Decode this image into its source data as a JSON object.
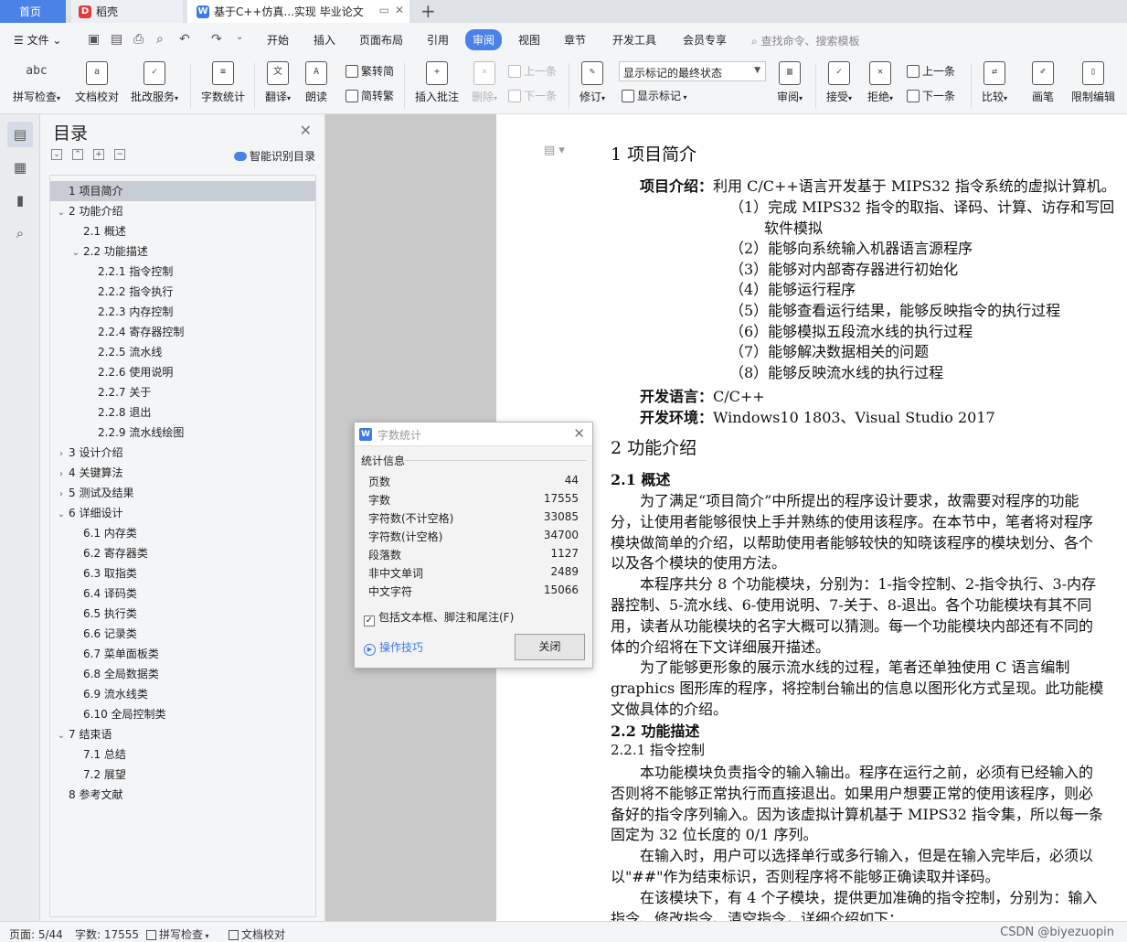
{
  "tabs": {
    "home": "首页",
    "daoke": "稻壳",
    "doc": "基于C++仿真...实现 毕业论文",
    "add": "+"
  },
  "menubar": {
    "file": "文件",
    "items": [
      "开始",
      "插入",
      "页面布局",
      "引用",
      "审阅",
      "视图",
      "章节",
      "开发工具",
      "会员专享"
    ],
    "active_index": 4,
    "search_placeholder": "查找命令、搜索模板"
  },
  "ribbon": {
    "spell_check": "拼写检查",
    "doc_proof": "文档校对",
    "review_service": "批改服务",
    "word_count": "字数统计",
    "translate": "翻译",
    "read_aloud": "朗读",
    "trad_to_simp": "繁转简",
    "simp_to_trad": "简转繁",
    "insert_comment": "插入批注",
    "delete": "删除",
    "prev_comment": "上一条",
    "next_comment": "下一条",
    "track_changes": "修订",
    "markup_mode": "显示标记的最终状态",
    "show_markup": "显示标记",
    "review_pane": "审阅",
    "accept": "接受",
    "reject": "拒绝",
    "prev_change": "上一条",
    "next_change": "下一条",
    "compare": "比较",
    "pen": "画笔",
    "restrict_edit": "限制编辑"
  },
  "toc": {
    "title": "目录",
    "smart_recognize": "智能识别目录",
    "items": [
      {
        "label": "1  项目简介",
        "level": 0,
        "chev": "",
        "selected": true
      },
      {
        "label": "2  功能介绍",
        "level": 0,
        "chev": "v"
      },
      {
        "label": "2.1  概述",
        "level": 1,
        "chev": ""
      },
      {
        "label": "2.2  功能描述",
        "level": 1,
        "chev": "v"
      },
      {
        "label": "2.2.1  指令控制",
        "level": 2,
        "chev": ""
      },
      {
        "label": "2.2.2  指令执行",
        "level": 2,
        "chev": ""
      },
      {
        "label": "2.2.3  内存控制",
        "level": 2,
        "chev": ""
      },
      {
        "label": "2.2.4  寄存器控制",
        "level": 2,
        "chev": ""
      },
      {
        "label": "2.2.5  流水线",
        "level": 2,
        "chev": ""
      },
      {
        "label": "2.2.6  使用说明",
        "level": 2,
        "chev": ""
      },
      {
        "label": "2.2.7  关于",
        "level": 2,
        "chev": ""
      },
      {
        "label": "2.2.8  退出",
        "level": 2,
        "chev": ""
      },
      {
        "label": "2.2.9  流水线绘图",
        "level": 2,
        "chev": ""
      },
      {
        "label": "3  设计介绍",
        "level": 0,
        "chev": ">"
      },
      {
        "label": "4  关键算法",
        "level": 0,
        "chev": ">"
      },
      {
        "label": "5  测试及结果",
        "level": 0,
        "chev": ">"
      },
      {
        "label": "6  详细设计",
        "level": 0,
        "chev": "v"
      },
      {
        "label": "6.1  内存类",
        "level": 1,
        "chev": ""
      },
      {
        "label": "6.2  寄存器类",
        "level": 1,
        "chev": ""
      },
      {
        "label": "6.3  取指类",
        "level": 1,
        "chev": ""
      },
      {
        "label": "6.4  译码类",
        "level": 1,
        "chev": ""
      },
      {
        "label": "6.5  执行类",
        "level": 1,
        "chev": ""
      },
      {
        "label": "6.6  记录类",
        "level": 1,
        "chev": ""
      },
      {
        "label": "6.7  菜单面板类",
        "level": 1,
        "chev": ""
      },
      {
        "label": "6.8  全局数据类",
        "level": 1,
        "chev": ""
      },
      {
        "label": "6.9  流水线类",
        "level": 1,
        "chev": ""
      },
      {
        "label": "6.10  全局控制类",
        "level": 1,
        "chev": ""
      },
      {
        "label": "7  结束语",
        "level": 0,
        "chev": "v"
      },
      {
        "label": "7.1  总结",
        "level": 1,
        "chev": ""
      },
      {
        "label": "7.2  展望",
        "level": 1,
        "chev": ""
      },
      {
        "label": "8  参考文献",
        "level": 0,
        "chev": ""
      }
    ]
  },
  "document": {
    "h1_intro": "1  项目简介",
    "intro_label": "项目介绍：",
    "intro_text": "利用 C/C++语言开发基于 MIPS32 指令系统的虚拟计算机。",
    "features": [
      "（1）完成 MIPS32 指令的取指、译码、计算、访存和写回",
      "软件模拟",
      "（2）能够向系统输入机器语言源程序",
      "（3）能够对内部寄存器进行初始化",
      "（4）能够运行程序",
      "（5）能够查看运行结果，能够反映指令的执行过程",
      "（6）能够模拟五段流水线的执行过程",
      "（7）能够解决数据相关的问题",
      "（8）能够反映流水线的执行过程"
    ],
    "lang_label": "开发语言：",
    "lang_value": "C/C++",
    "env_label": "开发环境：",
    "env_value": "Windows10 1803、Visual Studio 2017",
    "h1_func": "2  功能介绍",
    "h2_overview": "2.1  概述",
    "para_lines": [
      "为了满足“项目简介”中所提出的程序设计要求，故需要对程序的功能",
      "分，让使用者能够很快上手并熟练的使用该程序。在本节中，笔者将对程序",
      "模块做简单的介绍，以帮助使用者能够较快的知晓该程序的模块划分、各个",
      "以及各个模块的使用方法。",
      "本程序共分 8 个功能模块，分别为：1-指令控制、2-指令执行、3-内存",
      "器控制、5-流水线、6-使用说明、7-关于、8-退出。各个功能模块有其不同",
      "用，读者从功能模块的名字大概可以猜测。每一个功能模块内部还有不同的",
      "体的介绍将在下文详细展开描述。",
      "为了能够更形象的展示流水线的过程，笔者还单独使用 C 语言编制",
      "graphics 图形库的程序，将控制台输出的信息以图形化方式呈现。此功能模",
      "文做具体的介绍。"
    ],
    "h2_desc": "2.2  功能描述",
    "h3_inst": "2.2.1  指令控制",
    "para2_lines": [
      "本功能模块负责指令的输入输出。程序在运行之前，必须有已经输入的",
      "否则将不能够正常执行而直接退出。如果用户想要正常的使用该程序，则必",
      "备好的指令序列输入。因为该虚拟计算机基于 MIPS32 指令集，所以每一条",
      "固定为 32 位长度的 0/1 序列。",
      "在输入时，用户可以选择单行或多行输入，但是在输入完毕后，必须以",
      "以\"##\"作为结束标识，否则程序将不能够正确读取并译码。",
      "在该模块下，有 4 个子模块，提供更加准确的指令控制，分别为：输入",
      "指令、修改指令、清空指令，详细介绍如下："
    ]
  },
  "word_count_dialog": {
    "title": "字数统计",
    "section": "统计信息",
    "rows": [
      {
        "label": "页数",
        "value": "44"
      },
      {
        "label": "字数",
        "value": "17555"
      },
      {
        "label": "字符数(不计空格)",
        "value": "33085"
      },
      {
        "label": "字符数(计空格)",
        "value": "34700"
      },
      {
        "label": "段落数",
        "value": "1127"
      },
      {
        "label": "非中文单词",
        "value": "2489"
      },
      {
        "label": "中文字符",
        "value": "15066"
      }
    ],
    "include_label": "包括文本框、脚注和尾注(F)",
    "include_checked": true,
    "tips": "操作技巧",
    "close_button": "关闭"
  },
  "statusbar": {
    "page": "页面: 5/44",
    "words": "字数: 17555",
    "spell": "拼写检查",
    "proof": "文档校对",
    "watermark": "CSDN @biyezuopin"
  },
  "colors": {
    "accent": "#4a82e8",
    "ribbon_bg": "#f4f5f7",
    "doc_bg": "#c9c9c9"
  }
}
